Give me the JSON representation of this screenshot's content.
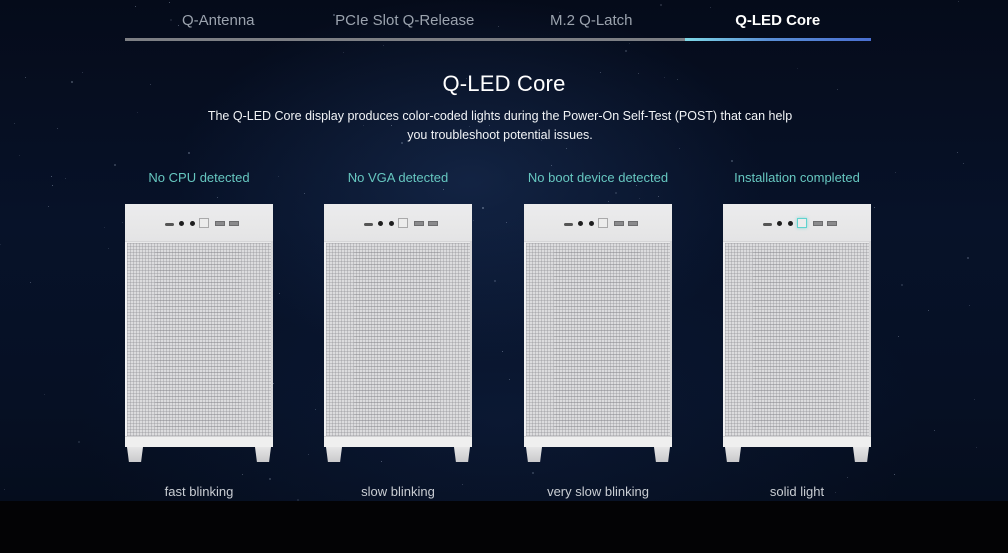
{
  "tabs": [
    {
      "label": "Q-Antenna",
      "active": false
    },
    {
      "label": "PCIe Slot Q-Release",
      "active": false
    },
    {
      "label": "M.2 Q-Latch",
      "active": false
    },
    {
      "label": "Q-LED Core",
      "active": true
    }
  ],
  "section": {
    "title": "Q-LED Core",
    "description": "The Q-LED Core display produces color-coded lights during the Power-On Self-Test (POST) that can help you troubleshoot potential issues."
  },
  "colors": {
    "accent_teal": "#66c7c0",
    "active_tab_bar_start": "#7fd8e6",
    "active_tab_bar_end": "#4a6fd0",
    "led_on": "#5fd3cf"
  },
  "states": [
    {
      "status": "No CPU detected",
      "caption": "fast blinking",
      "led_lit": false
    },
    {
      "status": "No VGA detected",
      "caption": "slow blinking",
      "led_lit": false
    },
    {
      "status": "No boot device detected",
      "caption": "very slow blinking",
      "led_lit": false
    },
    {
      "status": "Installation completed",
      "caption": "solid light",
      "led_lit": true
    }
  ]
}
